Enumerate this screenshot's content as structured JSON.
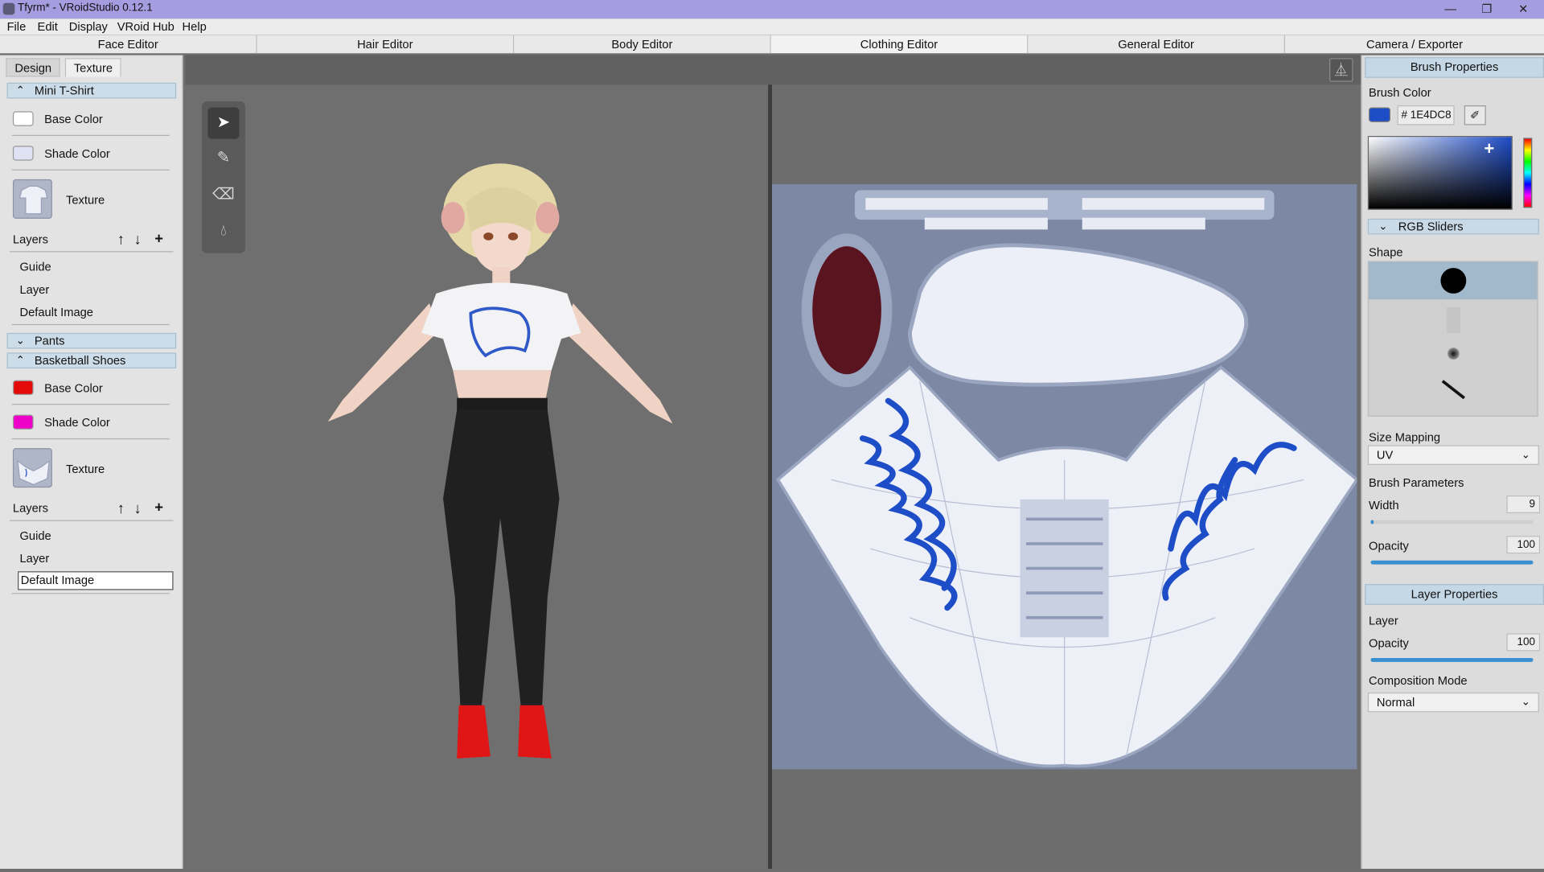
{
  "window": {
    "title": "Tfyrm* - VRoidStudio 0.12.1"
  },
  "menu": [
    "File",
    "Edit",
    "Display",
    "VRoid Hub",
    "Help"
  ],
  "editor_tabs": [
    "Face Editor",
    "Hair Editor",
    "Body Editor",
    "Clothing Editor",
    "General Editor",
    "Camera / Exporter"
  ],
  "left": {
    "tabs": {
      "design": "Design",
      "texture": "Texture"
    },
    "shirt": {
      "title": "Mini T-Shirt",
      "base_color_label": "Base Color",
      "base_color": "#ffffff",
      "shade_color_label": "Shade Color",
      "shade_color": "#dfe2f3",
      "texture_label": "Texture",
      "layers_label": "Layers",
      "layers": [
        "Guide",
        "Layer",
        "Default Image"
      ]
    },
    "pants": {
      "title": "Pants"
    },
    "shoes": {
      "title": "Basketball Shoes",
      "base_color_label": "Base Color",
      "base_color": "#e50a0a",
      "shade_color_label": "Shade Color",
      "shade_color": "#ee00c8",
      "texture_label": "Texture",
      "layers_label": "Layers",
      "layers": [
        "Guide",
        "Layer",
        "Default Image"
      ]
    }
  },
  "right": {
    "brush_properties": "Brush Properties",
    "brush_color_label": "Brush Color",
    "brush_color": "#1E4DC8",
    "hex_value": "# 1E4DC8",
    "rgb_sliders": "RGB Sliders",
    "shape_label": "Shape",
    "size_mapping_label": "Size Mapping",
    "size_mapping_value": "UV",
    "brush_parameters": "Brush Parameters",
    "width_label": "Width",
    "width_value": "9",
    "opacity_label": "Opacity",
    "opacity_value": "100",
    "layer_properties": "Layer Properties",
    "layer_label": "Layer",
    "layer_opacity_label": "Opacity",
    "layer_opacity_value": "100",
    "composition_mode_label": "Composition Mode",
    "composition_mode_value": "Normal"
  },
  "icons": {
    "window_controls": [
      "minimize-icon",
      "restore-icon",
      "close-icon"
    ],
    "tools": [
      "select-arrow-icon",
      "pen-icon",
      "eraser-icon",
      "fill-drop-icon"
    ]
  }
}
